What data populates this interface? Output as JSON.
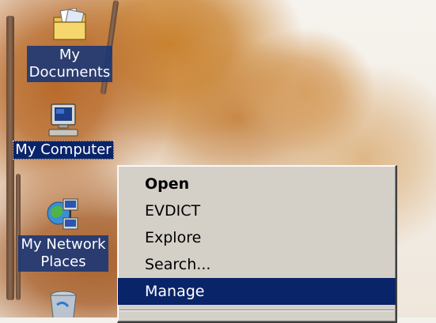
{
  "desktop": {
    "icons": [
      {
        "id": "my-documents",
        "label_line1": "My",
        "label_line2": "Documents",
        "icon": "folder-icon"
      },
      {
        "id": "my-computer",
        "label": "My Computer",
        "icon": "computer-icon"
      },
      {
        "id": "my-network-places",
        "label_line1": "My Network",
        "label_line2": "Places",
        "icon": "network-icon"
      },
      {
        "id": "recycle-bin",
        "icon": "recycle-bin-icon"
      }
    ]
  },
  "context_menu": {
    "items": [
      {
        "label": "Open",
        "bold": true
      },
      {
        "label": "EVDICT"
      },
      {
        "label": "Explore"
      },
      {
        "label": "Search..."
      },
      {
        "label": "Manage",
        "selected": true
      }
    ]
  },
  "colors": {
    "selection": "#0a246a",
    "menu_bg": "#d4d0c8",
    "selected_text": "#ffffff"
  }
}
